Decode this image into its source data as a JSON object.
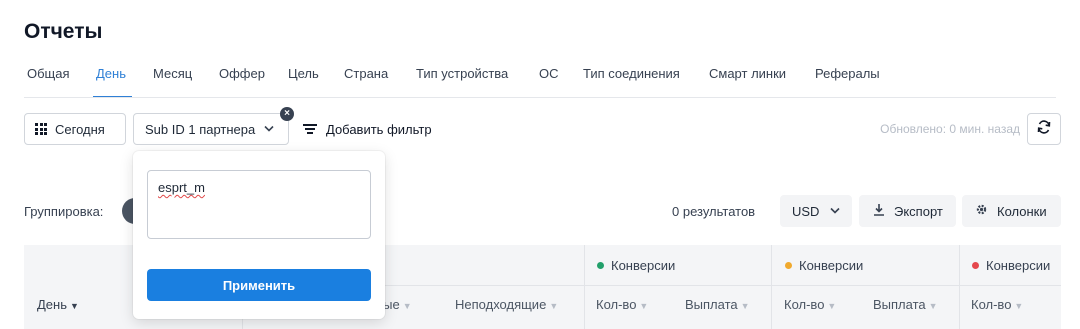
{
  "page": {
    "title": "Отчеты"
  },
  "tabs": [
    {
      "label": "Общая"
    },
    {
      "label": "День",
      "active": true
    },
    {
      "label": "Месяц"
    },
    {
      "label": "Оффер"
    },
    {
      "label": "Цель"
    },
    {
      "label": "Страна"
    },
    {
      "label": "Тип устройства"
    },
    {
      "label": "ОС"
    },
    {
      "label": "Тип соединения"
    },
    {
      "label": "Смарт линки"
    },
    {
      "label": "Рефералы"
    }
  ],
  "toolbar": {
    "date_label": "Сегодня",
    "subid_label": "Sub ID 1 партнера",
    "add_filter_label": "Добавить фильтр",
    "updated_text": "Обновлено: 0 мин. назад"
  },
  "popover": {
    "input_value": "esprt_m",
    "apply_label": "Применить"
  },
  "grouping": {
    "label": "Группировка:"
  },
  "results": {
    "count_text": "0 результатов",
    "currency": "USD",
    "export_label": "Экспорт",
    "columns_label": "Колонки"
  },
  "table": {
    "day_header": "День",
    "groups": [
      {
        "label": "Конверсии",
        "color": "#22a06b"
      },
      {
        "label": "Конверсии",
        "color": "#f0a92e"
      },
      {
        "label": "Конверсии",
        "color": "#e5484d"
      }
    ],
    "sub_headers": {
      "partial": "ные",
      "unsuitable": "Неподходящие",
      "count1": "Кол-во",
      "payout1": "Выплата",
      "count2": "Кол-во",
      "payout2": "Выплата",
      "count3": "Кол-во"
    }
  },
  "colors": {
    "accent": "#2f80d6",
    "apply_button": "#1a7fe0"
  }
}
